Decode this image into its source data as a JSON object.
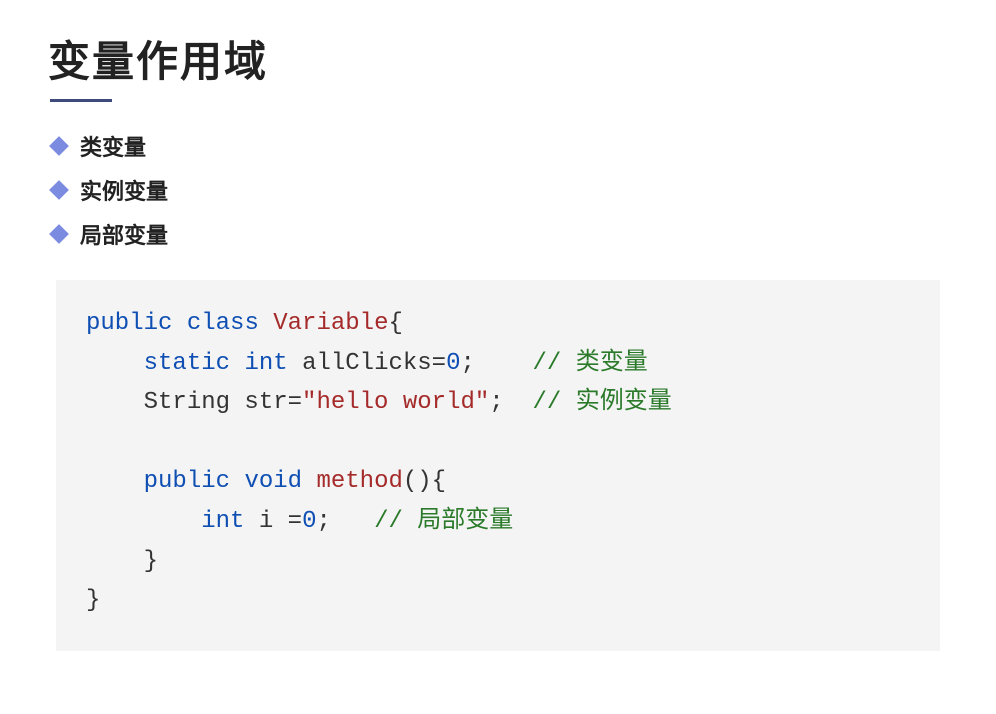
{
  "title": "变量作用域",
  "bullets": [
    {
      "label": "类变量"
    },
    {
      "label": "实例变量"
    },
    {
      "label": "局部变量"
    }
  ],
  "code": {
    "line1_kw1": "public",
    "line1_kw2": "class",
    "line1_cls": "Variable",
    "line1_brace": "{",
    "line2_kw1": "static",
    "line2_kw2": "int",
    "line2_ident": "allClicks=",
    "line2_num": "0",
    "line2_semi": ";",
    "line2_cmt": "// 类变量",
    "line3_type": "String str=",
    "line3_str": "\"hello world\"",
    "line3_semi": ";",
    "line3_cmt": "// 实例变量",
    "line5_kw1": "public",
    "line5_kw2": "void",
    "line5_method": "method",
    "line5_parens": "(){",
    "line6_kw": "int",
    "line6_ident": "i =",
    "line6_num": "0",
    "line6_semi": ";",
    "line6_cmt": "// 局部变量",
    "line7_brace": "}",
    "line8_brace": "}"
  }
}
